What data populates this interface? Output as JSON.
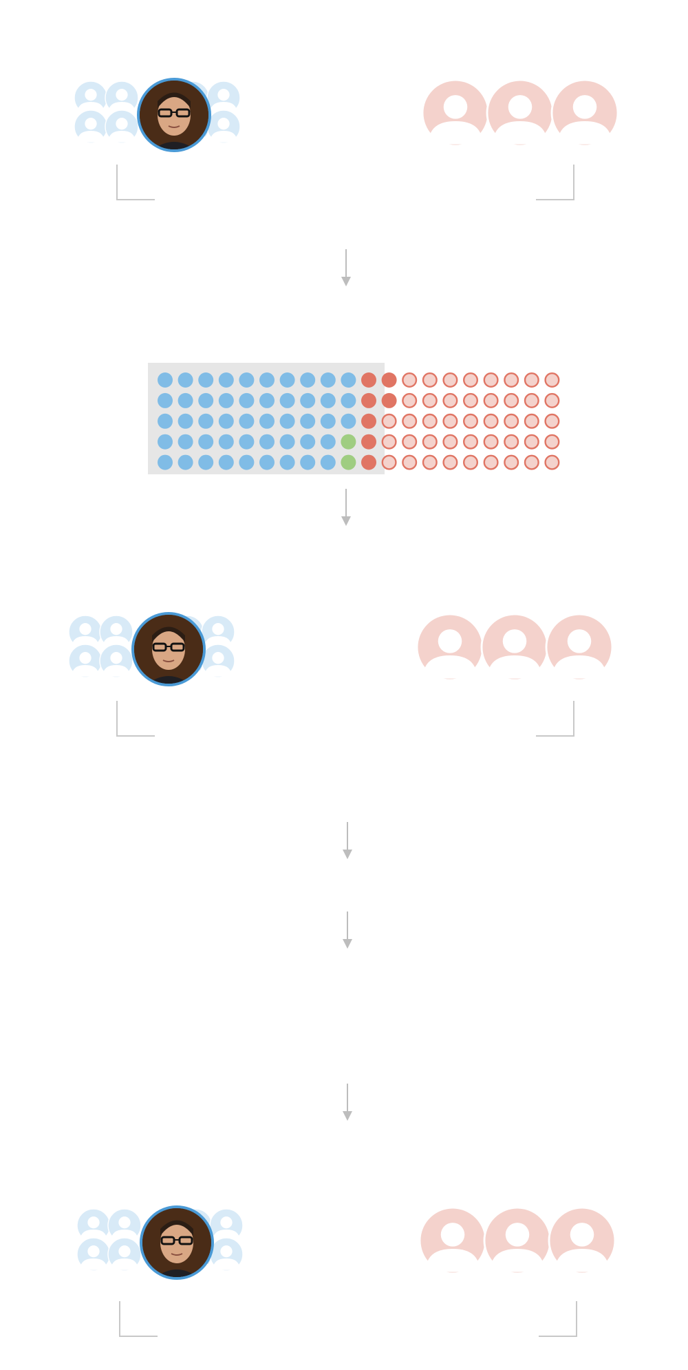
{
  "colors": {
    "democrat": "#80bce6",
    "democrat_light": "#d8eaf7",
    "republican": "#e07564",
    "republican_light": "#f4d2cc",
    "independent": "#9fcd81",
    "connector": "#bdbdbd",
    "highlight_bg": "#e6e6e6",
    "portrait_ring": "#4a9ad6"
  },
  "icons": {
    "person": "person-icon",
    "portrait": "portrait-photo",
    "arrow": "arrow-down-icon",
    "bracket": "bracket-connector"
  },
  "sections": [
    {
      "id": "stage-1",
      "democrat_group_size": 8,
      "republican_group_size": 3,
      "has_portrait": true
    },
    {
      "id": "stage-2",
      "democrat_group_size": 8,
      "republican_group_size": 3,
      "has_portrait": true
    },
    {
      "id": "stage-3",
      "democrat_group_size": 8,
      "republican_group_size": 3,
      "has_portrait": true
    }
  ],
  "chart_data": {
    "type": "waffle",
    "rows": 5,
    "columns": 20,
    "fill_order": "column-major",
    "highlighted_group": "democrat_and_independent_plus_majority",
    "segments": [
      {
        "party": "democrat",
        "count": 47,
        "style": "filled"
      },
      {
        "party": "independent",
        "count": 2,
        "style": "filled"
      },
      {
        "party": "republican",
        "count": 7,
        "style": "filled"
      },
      {
        "party": "republican",
        "count": 44,
        "style": "outline"
      }
    ]
  }
}
